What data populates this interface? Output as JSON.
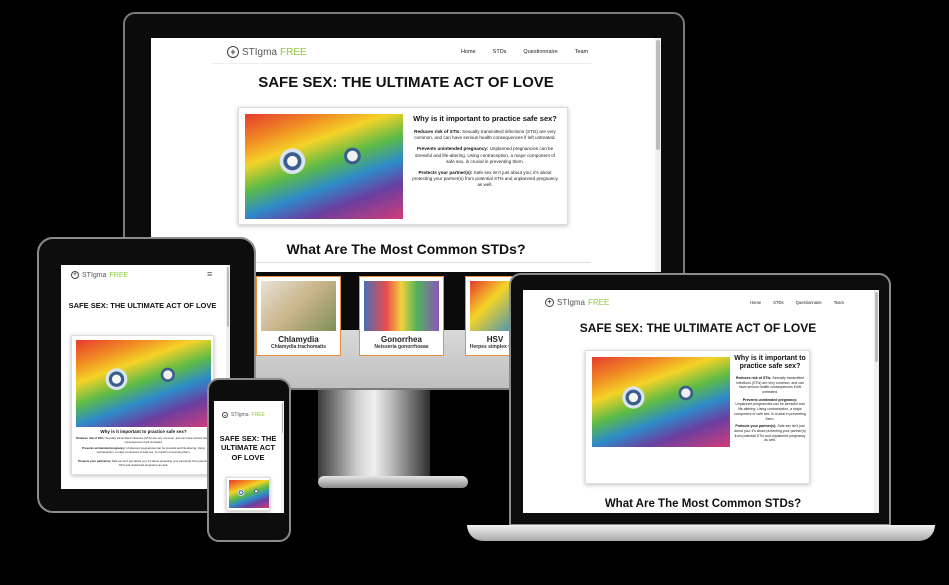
{
  "site": {
    "brand_part1": "STIgma",
    "brand_part2": "FREE",
    "nav": [
      "Home",
      "STDs",
      "Questionnaire",
      "Team"
    ],
    "menu_icon": "hamburger-icon",
    "logo_icon": "plus-circle-icon"
  },
  "hero": {
    "title": "SAFE SEX: THE ULTIMATE ACT OF LOVE",
    "title_tablet": "SAFE SEX: THE ULTIMATE ACT OF LOVE",
    "title_phone": "SAFE SEX: THE ULTIMATE ACT OF LOVE"
  },
  "why": {
    "heading": "Why is it important to practice safe sex?",
    "p1_label": "Reduces risk of STIs:",
    "p1_text": " Sexually transmitted infections (STIs) are very common, and can have serious health consequences if left untreated.",
    "p2_label": "Prevents unintended pregnancy:",
    "p2_text": " Unplanned pregnancies can be stressful and life-altering. Using contraception, a major component of safe sex, is crucial in preventing them.",
    "p3_label": "Protects your partner(s):",
    "p3_text": " Safe sex isn't just about you; it's about protecting your partner(s) from potential STIs and unplanned pregnancy as well."
  },
  "stds": {
    "heading": "What Are The Most Common STDs?",
    "items": [
      {
        "name": "Chlamydia",
        "sci": "Chlamydia trachomatis"
      },
      {
        "name": "Gonorrhea",
        "sci": "Neisseria gonorrhoeae"
      },
      {
        "name": "HSV",
        "sci": "Herpes simplex virus"
      }
    ]
  },
  "colors": {
    "background": "#000000",
    "accent_green": "#8fc93a",
    "card_border_orange": "#e8913a"
  }
}
